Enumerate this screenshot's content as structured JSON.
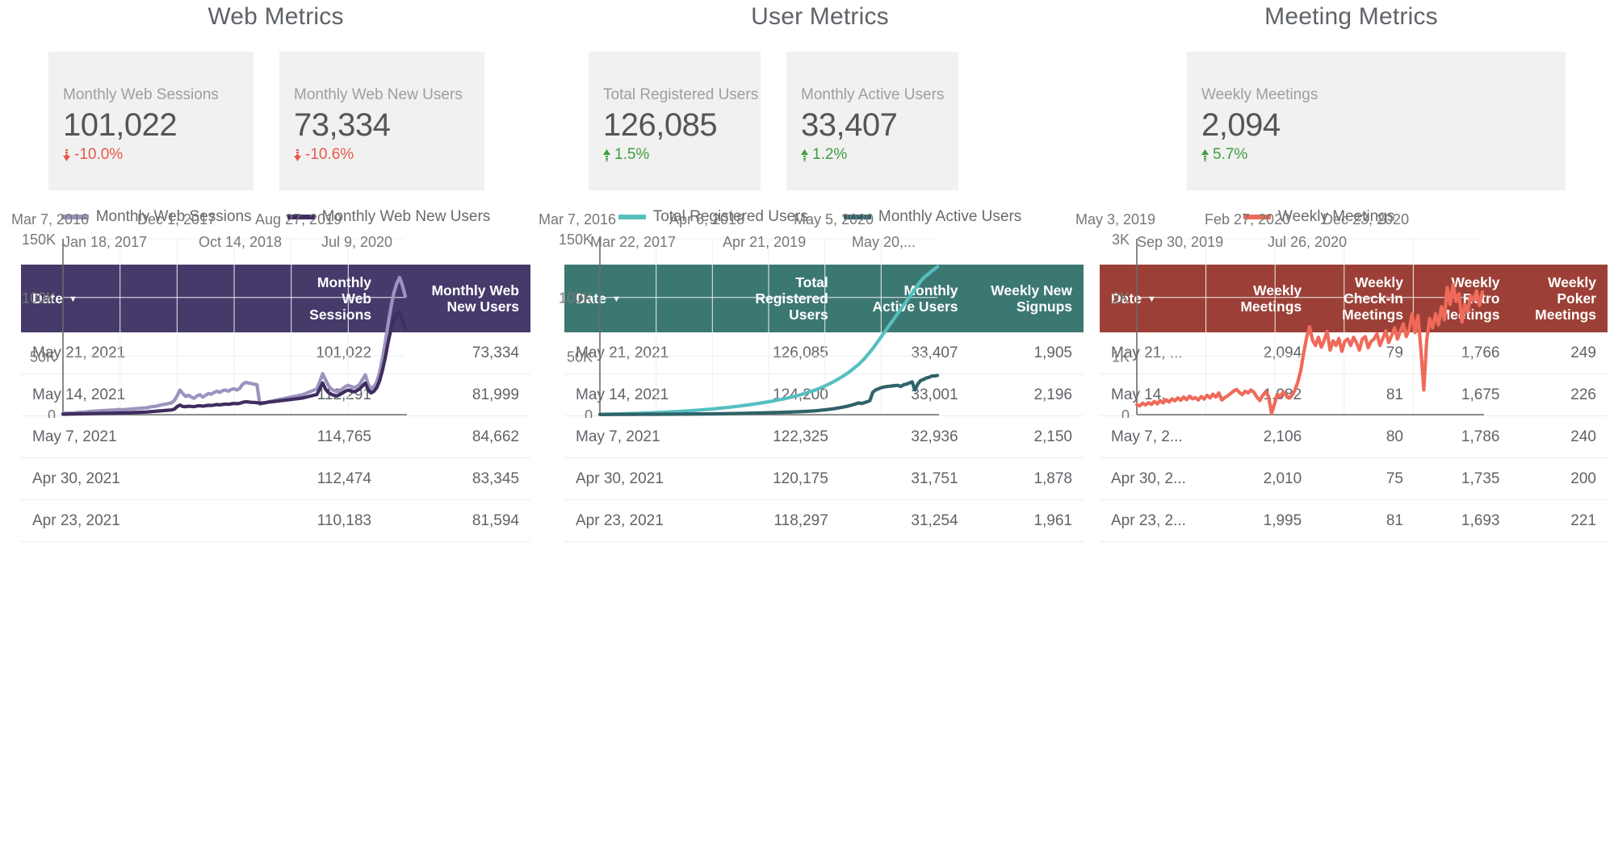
{
  "columns": [
    {
      "id": "web",
      "title": "Web Metrics",
      "accent": "#463a6b",
      "scorecards": [
        {
          "label": "Monthly Web Sessions",
          "value": "101,022",
          "delta": "-10.0%",
          "direction": "down"
        },
        {
          "label": "Monthly Web New Users",
          "value": "73,334",
          "delta": "-10.6%",
          "direction": "down"
        }
      ],
      "chart_data": {
        "type": "line",
        "title": "",
        "xlabel": "",
        "ylabel": "",
        "ylim": [
          0,
          150000
        ],
        "ytick_labels": [
          "150K",
          "100K",
          "50K",
          "0"
        ],
        "yticks": [
          150000,
          100000,
          50000,
          0
        ],
        "grid": true,
        "legend_position": "top-center",
        "x_tick_labels": [
          "Mar 7, 2016",
          "Jan 18, 2017",
          "Dec 1, 2017",
          "Oct 14, 2018",
          "Aug 27, 2019",
          "Jul 9, 2020"
        ],
        "series": [
          {
            "name": "Monthly Web Sessions",
            "color": "#9d93bf",
            "values": [
              1100,
              1200,
              1300,
              1400,
              1500,
              1800,
              2000,
              2100,
              2300,
              2600,
              2800,
              3000,
              3100,
              3300,
              3500,
              3600,
              3700,
              3900,
              4000,
              4200,
              4300,
              4100,
              4400,
              4600,
              4800,
              5000,
              5200,
              5400,
              5600,
              5800,
              6200,
              6800,
              7000,
              7400,
              8000,
              8600,
              9000,
              9500,
              10000,
              12000,
              16000,
              21000,
              18000,
              15500,
              16500,
              15000,
              14000,
              16000,
              17000,
              15000,
              16500,
              18000,
              17500,
              19000,
              20000,
              19000,
              20500,
              21000,
              20000,
              21500,
              22000,
              21000,
              22500,
              26000,
              27500,
              27000,
              26500,
              26000,
              25500,
              9000,
              9500,
              10000,
              11000,
              11500,
              12000,
              12500,
              13000,
              13500,
              14000,
              14500,
              15000,
              15500,
              16000,
              16500,
              17000,
              18000,
              19000,
              20000,
              21000,
              22000,
              28000,
              35000,
              30000,
              25000,
              22000,
              20500,
              19500,
              20500,
              22000,
              24000,
              25000,
              24000,
              23000,
              24000,
              26000,
              30000,
              34000,
              26000,
              22000,
              24000,
              28000,
              36000,
              48000,
              62000,
              78000,
              92000,
              104000,
              112000,
              117000,
              110000,
              101022
            ]
          },
          {
            "name": "Monthly Web New Users",
            "color": "#3f2d60",
            "values": [
              400,
              450,
              500,
              550,
              600,
              650,
              700,
              750,
              800,
              850,
              900,
              950,
              1000,
              1050,
              1100,
              1150,
              1200,
              1250,
              1300,
              1350,
              1400,
              1450,
              1500,
              1600,
              1700,
              1800,
              1900,
              2000,
              2100,
              2200,
              2400,
              2600,
              2800,
              3000,
              3200,
              3400,
              3600,
              3800,
              4000,
              4600,
              6800,
              8200,
              7000,
              6800,
              7200,
              7000,
              6800,
              7400,
              7600,
              7200,
              7600,
              8000,
              7800,
              8200,
              8600,
              8300,
              8700,
              9000,
              8800,
              9200,
              9600,
              9300,
              9700,
              10500,
              11000,
              10800,
              10500,
              10400,
              10200,
              9800,
              10000,
              10300,
              10600,
              10900,
              11200,
              11500,
              11800,
              12100,
              12400,
              12700,
              13000,
              13300,
              13600,
              13900,
              14200,
              14800,
              15400,
              16000,
              16600,
              17200,
              22000,
              27000,
              22000,
              19000,
              17500,
              16500,
              16000,
              17000,
              18500,
              20000,
              21000,
              20000,
              19500,
              20500,
              22000,
              24500,
              27000,
              21000,
              18500,
              20000,
              23000,
              29000,
              38000,
              49000,
              62000,
              73000,
              82000,
              86000,
              88000,
              80000,
              73334
            ]
          }
        ]
      },
      "table": {
        "columns": [
          {
            "label": "Date",
            "align": "l",
            "sortable": true,
            "sorted": true
          },
          {
            "label": "Monthly\nWeb\nSessions",
            "align": "r",
            "sortable": true,
            "sorted": false
          },
          {
            "label": "Monthly Web\nNew Users",
            "align": "r",
            "sortable": true,
            "sorted": false
          }
        ],
        "col_widths": [
          "42%",
          "29%",
          "29%"
        ],
        "rows": [
          [
            "May 21, 2021",
            "101,022",
            "73,334"
          ],
          [
            "May 14, 2021",
            "112,291",
            "81,999"
          ],
          [
            "May 7, 2021",
            "114,765",
            "84,662"
          ],
          [
            "Apr 30, 2021",
            "112,474",
            "83,345"
          ],
          [
            "Apr 23, 2021",
            "110,183",
            "81,594"
          ]
        ]
      }
    },
    {
      "id": "user",
      "title": "User Metrics",
      "accent": "#3c7872",
      "scorecards": [
        {
          "label": "Total Registered Users",
          "value": "126,085",
          "delta": "1.5%",
          "direction": "up"
        },
        {
          "label": "Monthly Active Users",
          "value": "33,407",
          "delta": "1.2%",
          "direction": "up"
        }
      ],
      "chart_data": {
        "type": "line",
        "title": "",
        "xlabel": "",
        "ylabel": "",
        "ylim": [
          0,
          150000
        ],
        "ytick_labels": [
          "150K",
          "100K",
          "50K",
          "0"
        ],
        "yticks": [
          150000,
          100000,
          50000,
          0
        ],
        "grid": true,
        "legend_position": "top-center",
        "x_tick_labels": [
          "Mar 7, 2016",
          "Mar 22, 2017",
          "Apr 6, 2018",
          "Apr 21, 2019",
          "May 5, 2020",
          "May 20,..."
        ],
        "series": [
          {
            "name": "Total Registered Users",
            "color": "#56bfc0",
            "values": [
              200,
              260,
              320,
              380,
              440,
              500,
              560,
              620,
              700,
              780,
              860,
              940,
              1020,
              1100,
              1200,
              1300,
              1400,
              1500,
              1600,
              1700,
              1820,
              1940,
              2060,
              2180,
              2300,
              2440,
              2580,
              2720,
              2860,
              3000,
              3180,
              3360,
              3540,
              3720,
              3900,
              4100,
              4300,
              4500,
              4700,
              4900,
              5150,
              5400,
              5650,
              5900,
              6150,
              6450,
              6750,
              7050,
              7350,
              7650,
              8000,
              8350,
              8700,
              9050,
              9400,
              9800,
              10200,
              10600,
              11000,
              11400,
              11900,
              12400,
              12900,
              13400,
              13900,
              14500,
              15100,
              15700,
              16300,
              17000,
              17800,
              18600,
              19400,
              20200,
              21000,
              22000,
              23000,
              24000,
              25200,
              26400,
              27700,
              29000,
              30500,
              32000,
              33500,
              35200,
              37000,
              39000,
              41000,
              43000,
              45500,
              48000,
              51000,
              54000,
              57000,
              60500,
              64000,
              67500,
              71000,
              74500,
              78000,
              81500,
              85000,
              88500,
              92000,
              95500,
              99000,
              102500,
              106000,
              109500,
              113000,
              116000,
              118297,
              120175,
              122325,
              124200,
              126085
            ]
          },
          {
            "name": "Monthly Active Users",
            "color": "#2f6269",
            "values": [
              150,
              160,
              170,
              180,
              190,
              200,
              210,
              220,
              230,
              240,
              250,
              260,
              270,
              280,
              290,
              300,
              310,
              320,
              330,
              340,
              350,
              365,
              380,
              395,
              410,
              425,
              440,
              455,
              470,
              485,
              500,
              520,
              540,
              560,
              580,
              600,
              620,
              640,
              660,
              680,
              710,
              740,
              770,
              800,
              830,
              870,
              910,
              950,
              990,
              1030,
              1080,
              1130,
              1180,
              1230,
              1280,
              1340,
              1400,
              1460,
              1520,
              1580,
              1650,
              1720,
              1790,
              1860,
              1930,
              2010,
              2090,
              2170,
              2250,
              2350,
              2450,
              2550,
              2650,
              2750,
              2900,
              3050,
              3200,
              3400,
              3600,
              3850,
              4100,
              4400,
              4700,
              5000,
              5400,
              5800,
              6200,
              6700,
              7200,
              7800,
              8500,
              9200,
              10000,
              9500,
              10200,
              11000,
              12000,
              19000,
              21000,
              22000,
              23000,
              23500,
              24000,
              24200,
              24500,
              24800,
              25000,
              24000,
              25500,
              26000,
              27000,
              28000,
              21000,
              26000,
              29000,
              30000,
              31254,
              31751,
              32936,
              33001,
              33407
            ]
          }
        ]
      },
      "table": {
        "columns": [
          {
            "label": "Date",
            "align": "l",
            "sortable": true,
            "sorted": true
          },
          {
            "label": "Total\nRegistered\nUsers",
            "align": "r",
            "sortable": true,
            "sorted": false
          },
          {
            "label": "Monthly\nActive Users",
            "align": "r",
            "sortable": true,
            "sorted": false
          },
          {
            "label": "Weekly New\nSignups",
            "align": "r",
            "sortable": true,
            "sorted": false
          }
        ],
        "col_widths": [
          "27%",
          "26%",
          "25%",
          "22%"
        ],
        "rows": [
          [
            "May 21, 2021",
            "126,085",
            "33,407",
            "1,905"
          ],
          [
            "May 14, 2021",
            "124,200",
            "33,001",
            "2,196"
          ],
          [
            "May 7, 2021",
            "122,325",
            "32,936",
            "2,150"
          ],
          [
            "Apr 30, 2021",
            "120,175",
            "31,751",
            "1,878"
          ],
          [
            "Apr 23, 2021",
            "118,297",
            "31,254",
            "1,961"
          ]
        ]
      }
    },
    {
      "id": "meet",
      "title": "Meeting Metrics",
      "accent": "#9c4037",
      "scorecards": [
        {
          "label": "Weekly Meetings",
          "value": "2,094",
          "delta": "5.7%",
          "direction": "up"
        }
      ],
      "chart_data": {
        "type": "line",
        "title": "",
        "xlabel": "",
        "ylabel": "",
        "ylim": [
          0,
          3000
        ],
        "ytick_labels": [
          "3K",
          "2K",
          "1K",
          "0"
        ],
        "yticks": [
          3000,
          2000,
          1000,
          0
        ],
        "grid": true,
        "legend_position": "top-left",
        "x_tick_labels": [
          "May 3, 2019",
          "Sep 30, 2019",
          "Feb 27, 2020",
          "Jul 26, 2020",
          "Dec 23, 2020"
        ],
        "series": [
          {
            "name": "Weekly Meetings",
            "color": "#ef6a5a",
            "values": [
              170,
              150,
              195,
              165,
              205,
              175,
              225,
              185,
              240,
              200,
              255,
              215,
              270,
              235,
              285,
              245,
              300,
              255,
              315,
              270,
              290,
              250,
              310,
              265,
              330,
              285,
              350,
              300,
              370,
              250,
              290,
              320,
              360,
              400,
              430,
              380,
              340,
              400,
              370,
              420,
              380,
              300,
              240,
              330,
              390,
              310,
              20,
              180,
              350,
              300,
              390,
              330,
              280,
              330,
              420,
              560,
              760,
              1060,
              1320,
              1500,
              1270,
              1180,
              1320,
              1150,
              1270,
              1420,
              1100,
              1260,
              1180,
              1300,
              1080,
              1250,
              1290,
              1180,
              1320,
              1230,
              1100,
              1290,
              1330,
              1140,
              1250,
              1290,
              1380,
              1180,
              1300,
              1430,
              1230,
              1350,
              1480,
              1290,
              1420,
              1550,
              1330,
              1450,
              1720,
              1400,
              1690,
              1120,
              420,
              1280,
              1640,
              1480,
              1720,
              1530,
              1840,
              1620,
              2170,
              1880,
              2220,
              1930,
              2060,
              1580,
              1880,
              1760,
              2030,
              1950,
              2110,
              1860,
              2094
            ]
          }
        ]
      },
      "table": {
        "columns": [
          {
            "label": "Date",
            "align": "l",
            "sortable": true,
            "sorted": true
          },
          {
            "label": "Weekly\nMeetings",
            "align": "r",
            "sortable": true,
            "sorted": false
          },
          {
            "label": "Weekly\nCheck-In\nMeetings",
            "align": "r",
            "sortable": true,
            "sorted": false
          },
          {
            "label": "Weekly\nRetro\nMeetings",
            "align": "r",
            "sortable": true,
            "sorted": false
          },
          {
            "label": "Weekly\nPoker\nMeetings",
            "align": "r",
            "sortable": true,
            "sorted": false
          }
        ],
        "col_widths": [
          "22%",
          "20%",
          "20%",
          "19%",
          "19%"
        ],
        "rows": [
          [
            "May 21, ...",
            "2,094",
            "79",
            "1,766",
            "249"
          ],
          [
            "May 14, ...",
            "1,982",
            "81",
            "1,675",
            "226"
          ],
          [
            "May 7, 2...",
            "2,106",
            "80",
            "1,786",
            "240"
          ],
          [
            "Apr 30, 2...",
            "2,010",
            "75",
            "1,735",
            "200"
          ],
          [
            "Apr 23, 2...",
            "1,995",
            "81",
            "1,693",
            "221"
          ]
        ]
      }
    }
  ]
}
